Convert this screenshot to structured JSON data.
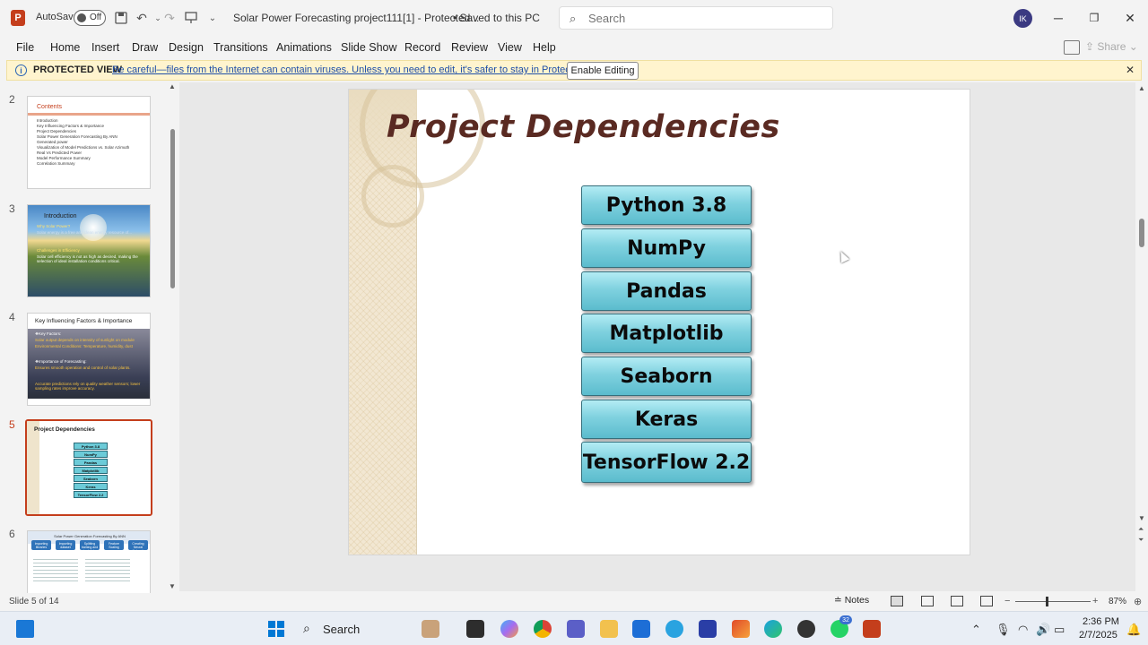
{
  "titlebar": {
    "app_letter": "P",
    "autosave_label": "AutoSave",
    "autosave_state": "Off",
    "doc_title": "Solar Power Forecasting project111[1]  -  Protected...",
    "saved_status": "•  Saved to this PC",
    "search_placeholder": "Search",
    "user_initials": "IK"
  },
  "menu": {
    "items": [
      "File",
      "Home",
      "Insert",
      "Draw",
      "Design",
      "Transitions",
      "Animations",
      "Slide Show",
      "Record",
      "Review",
      "View",
      "Help"
    ],
    "share_label": "Share"
  },
  "protected_view": {
    "title": "PROTECTED VIEW",
    "message": "Be careful—files from the Internet can contain viruses. Unless you need to edit, it's safer to stay in Protected View.",
    "enable_button": "Enable Editing"
  },
  "thumbnails": {
    "numbers": [
      "2",
      "3",
      "4",
      "5",
      "6"
    ],
    "slide2": {
      "heading": "Contents",
      "items": [
        "Introduction",
        "Key Influencing Factors & Importance",
        "Project Dependencies",
        "Solar Power Generation Forecasting By ANN",
        "Generated power",
        "Visualization of Model Predictions vs. Solar Azimuth",
        "Real Vs Predicted Power",
        "Model Performance Summary",
        "Correlation Summary"
      ]
    },
    "slide3": {
      "title": "Introduction",
      "line1": "Why Solar Power?",
      "line2": "Solar energy is a free and clean energy resource of...",
      "line3": "Challenges in Efficiency",
      "line4": "Solar cell efficiency is not as high as desired, making the selection of ideal installation conditions critical."
    },
    "slide4": {
      "title": "Key Influencing Factors & Importance",
      "line1": "❖Key Factors:",
      "line2": "Solar output depends on intensity of sunlight on module",
      "line3": "Environmental Conditions: Temperature, humidity, dust",
      "line4": "❖Importance of Forecasting:",
      "line5": "Ensures smooth operation and control of solar plants.",
      "line6": "Accurate predictions rely on quality weather sensors; lower sampling rates improve accuracy."
    },
    "slide5": {
      "title": "Project Dependencies",
      "items": [
        "Python 3.8",
        "NumPy",
        "Pandas",
        "Matplotlib",
        "Seaborn",
        "Keras",
        "TensorFlow 2.2"
      ]
    },
    "slide6": {
      "heading": "Solar Power Generation Forecasting By ANN",
      "boxes": [
        "Importing libraries",
        "Importing dataset",
        "Splitting training and test data",
        "Feature Scaling",
        "Creating Neural Network"
      ]
    }
  },
  "slide": {
    "title": "Project Dependencies",
    "dependencies": [
      "Python 3.8",
      "NumPy",
      "Pandas",
      "Matplotlib",
      "Seaborn",
      "Keras",
      "TensorFlow 2.2"
    ]
  },
  "status": {
    "slide_counter": "Slide 5 of 14",
    "notes_label": "Notes",
    "zoom": "87%"
  },
  "taskbar": {
    "search_label": "Search",
    "badge_count": "32",
    "time": "2:36 PM",
    "date": "2/7/2025"
  },
  "colors": {
    "accent": "#c43e1c",
    "title_color": "#5a2a22",
    "box_fill": "#7fd1df",
    "protected_bar": "#fff4ce"
  }
}
